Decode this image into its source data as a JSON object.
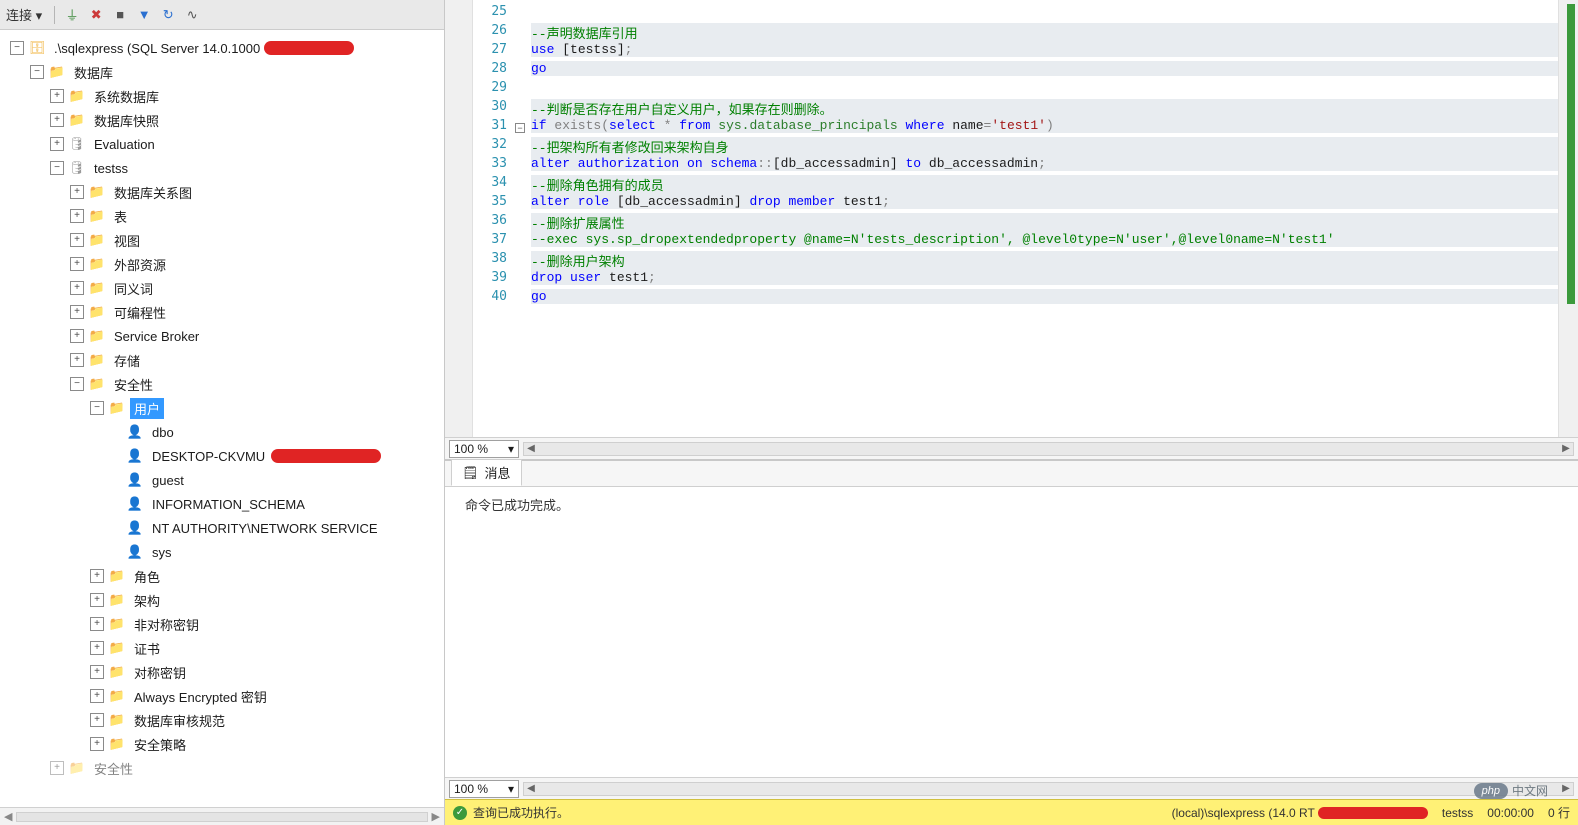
{
  "toolbar": {
    "label": "连接 ▾"
  },
  "tree": {
    "server": ".\\sqlexpress (SQL Server 14.0.1000",
    "databases": "数据库",
    "sysdb": "系统数据库",
    "snapshot": "数据库快照",
    "eval": "Evaluation",
    "testss": "testss",
    "diagrams": "数据库关系图",
    "tables": "表",
    "views": "视图",
    "ext": "外部资源",
    "synonyms": "同义词",
    "prog": "可编程性",
    "svcbroker": "Service Broker",
    "storage": "存储",
    "security": "安全性",
    "users": "用户",
    "dbo": "dbo",
    "desktop": "DESKTOP-CKVMU",
    "guest": "guest",
    "infoschema": "INFORMATION_SCHEMA",
    "ntauth": "NT AUTHORITY\\NETWORK SERVICE",
    "sys": "sys",
    "roles": "角色",
    "schemas": "架构",
    "asymkeys": "非对称密钥",
    "certs": "证书",
    "symkeys": "对称密钥",
    "alwaysenc": "Always Encrypted 密钥",
    "audit": "数据库审核规范",
    "secpolicy": "安全策略",
    "sec2": "安全性"
  },
  "editor": {
    "line_start": 25,
    "lines": [
      {
        "tokens": [
          {
            "t": "",
            "c": ""
          }
        ],
        "hl": true
      },
      {
        "tokens": [
          {
            "t": "--声明数据库引用",
            "c": "cmt"
          }
        ],
        "hl": true
      },
      {
        "tokens": [
          {
            "t": "use ",
            "c": "kw"
          },
          {
            "t": "[testss]",
            "c": ""
          },
          {
            "t": ";",
            "c": "op"
          }
        ],
        "hl": true
      },
      {
        "tokens": [
          {
            "t": "go",
            "c": "kw"
          }
        ],
        "hl": true
      },
      {
        "tokens": [
          {
            "t": "",
            "c": ""
          }
        ],
        "hl": true
      },
      {
        "tokens": [
          {
            "t": "--判断是否存在用户自定义用户，如果存在则删除。",
            "c": "cmt"
          }
        ],
        "hl": true
      },
      {
        "tokens": [
          {
            "t": "if ",
            "c": "kw"
          },
          {
            "t": "exists",
            "c": "op"
          },
          {
            "t": "(",
            "c": "op"
          },
          {
            "t": "select ",
            "c": "kw"
          },
          {
            "t": "* ",
            "c": "op"
          },
          {
            "t": "from ",
            "c": "kw"
          },
          {
            "t": "sys.database_principals",
            "c": "sys"
          },
          {
            "t": " where ",
            "c": "kw"
          },
          {
            "t": "name",
            "c": ""
          },
          {
            "t": "=",
            "c": "op"
          },
          {
            "t": "'test1'",
            "c": "str"
          },
          {
            "t": ")",
            "c": "op"
          }
        ],
        "hl": true,
        "fold": true
      },
      {
        "tokens": [
          {
            "t": "--把架构所有者修改回来架构自身",
            "c": "cmt"
          }
        ],
        "hl": true
      },
      {
        "tokens": [
          {
            "t": "alter authorization on schema",
            "c": "kw"
          },
          {
            "t": "::",
            "c": "op"
          },
          {
            "t": "[db_accessadmin] ",
            "c": ""
          },
          {
            "t": "to ",
            "c": "kw"
          },
          {
            "t": "db_accessadmin",
            "c": ""
          },
          {
            "t": ";",
            "c": "op"
          }
        ],
        "hl": true
      },
      {
        "tokens": [
          {
            "t": "--删除角色拥有的成员",
            "c": "cmt"
          }
        ],
        "hl": true
      },
      {
        "tokens": [
          {
            "t": "alter role ",
            "c": "kw"
          },
          {
            "t": "[db_accessadmin] ",
            "c": ""
          },
          {
            "t": "drop member ",
            "c": "kw"
          },
          {
            "t": "test1",
            "c": ""
          },
          {
            "t": ";",
            "c": "op"
          }
        ],
        "hl": true
      },
      {
        "tokens": [
          {
            "t": "--删除扩展属性",
            "c": "cmt"
          }
        ],
        "hl": true
      },
      {
        "tokens": [
          {
            "t": "--exec sys.sp_dropextendedproperty @name=N'tests_description', @level0type=N'user',@level0name=N'test1'",
            "c": "cmt"
          }
        ],
        "hl": true
      },
      {
        "tokens": [
          {
            "t": "--删除用户架构",
            "c": "cmt"
          }
        ],
        "hl": true
      },
      {
        "tokens": [
          {
            "t": "drop user ",
            "c": "kw"
          },
          {
            "t": "test1",
            "c": ""
          },
          {
            "t": ";",
            "c": "op"
          }
        ],
        "hl": true
      },
      {
        "tokens": [
          {
            "t": "go",
            "c": "kw"
          }
        ],
        "hl": true
      }
    ],
    "zoom": "100 %"
  },
  "messages": {
    "tab": "消息",
    "body": "命令已成功完成。",
    "zoom": "100 %"
  },
  "status": {
    "ok": "查询已成功执行。",
    "server": "(local)\\sqlexpress (14.0 RT",
    "db": "testss",
    "time": "00:00:00",
    "rows": "0 行"
  },
  "watermark": {
    "badge": "php",
    "cn": "中文网"
  }
}
